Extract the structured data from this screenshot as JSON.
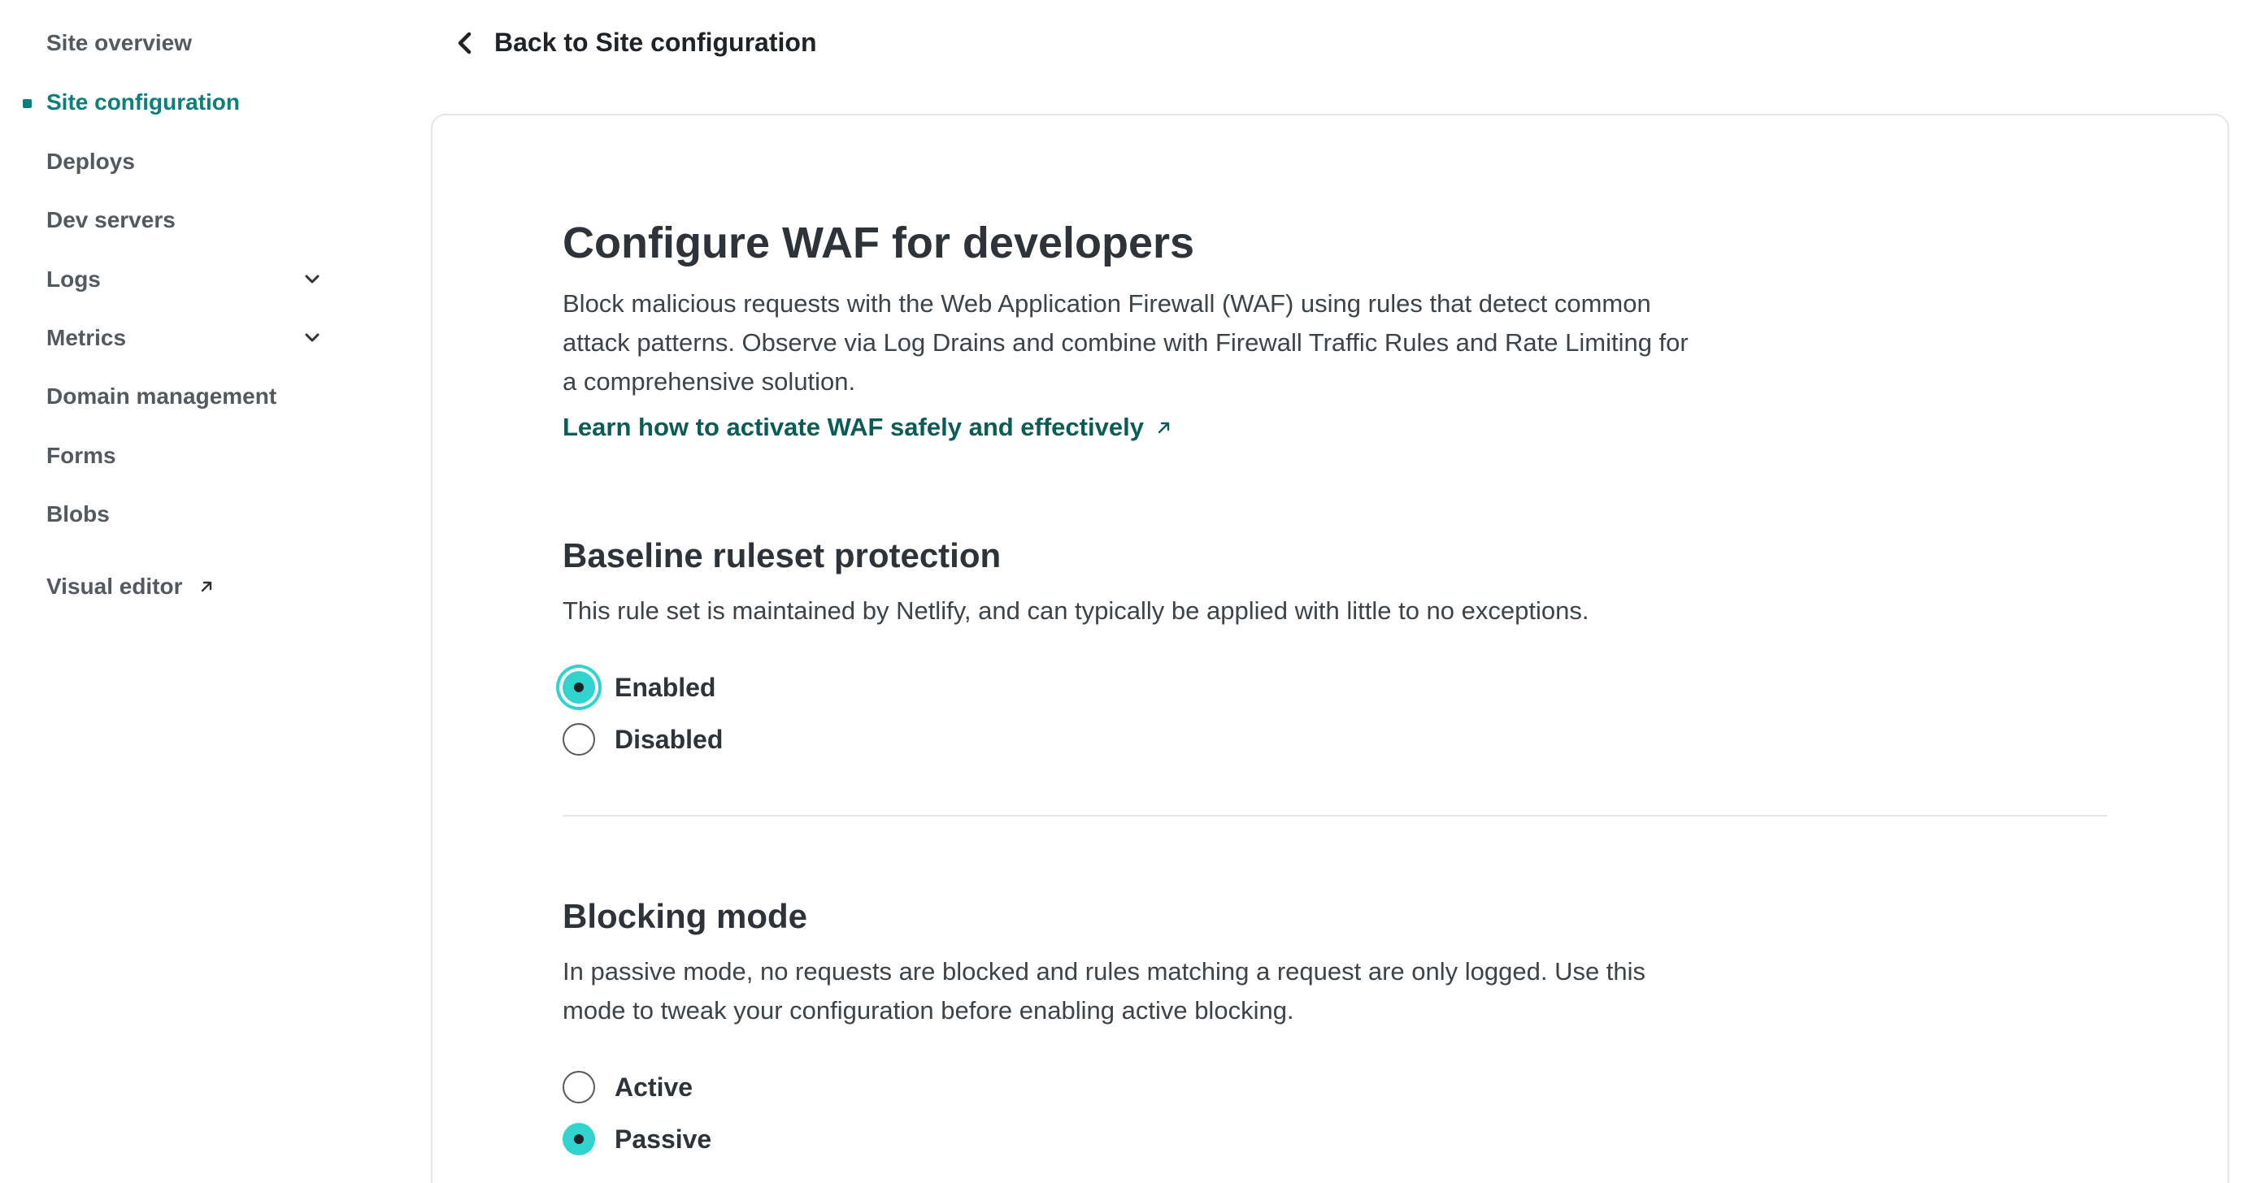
{
  "sidebar": {
    "items": [
      {
        "label": "Site overview"
      },
      {
        "label": "Site configuration"
      },
      {
        "label": "Deploys"
      },
      {
        "label": "Dev servers"
      },
      {
        "label": "Logs"
      },
      {
        "label": "Metrics"
      },
      {
        "label": "Domain management"
      },
      {
        "label": "Forms"
      },
      {
        "label": "Blobs"
      },
      {
        "label": "Visual editor"
      }
    ],
    "active_item": "Site configuration"
  },
  "header": {
    "back_label": "Back to Site configuration"
  },
  "main": {
    "title": "Configure WAF for developers",
    "description": "Block malicious requests with the Web Application Firewall (WAF) using rules that detect common attack patterns. Observe via Log Drains and combine with Firewall Traffic Rules and Rate Limiting for a comprehensive solution.",
    "learn_link": "Learn how to activate WAF safely and effectively",
    "baseline": {
      "heading": "Baseline ruleset protection",
      "description": "This rule set is maintained by Netlify, and can typically be applied with little to no exceptions.",
      "options": [
        {
          "label": "Enabled",
          "checked": true
        },
        {
          "label": "Disabled",
          "checked": false
        }
      ]
    },
    "blocking": {
      "heading": "Blocking mode",
      "description": "In passive mode, no requests are blocked and rules matching a request are only logged. Use this mode to tweak your configuration before enabling active blocking.",
      "options": [
        {
          "label": "Active",
          "checked": false
        },
        {
          "label": "Passive",
          "checked": true
        }
      ]
    }
  },
  "colors": {
    "accent": "#0b7f78",
    "radio_checked": "#30d3cd",
    "link": "#0a5c56"
  }
}
